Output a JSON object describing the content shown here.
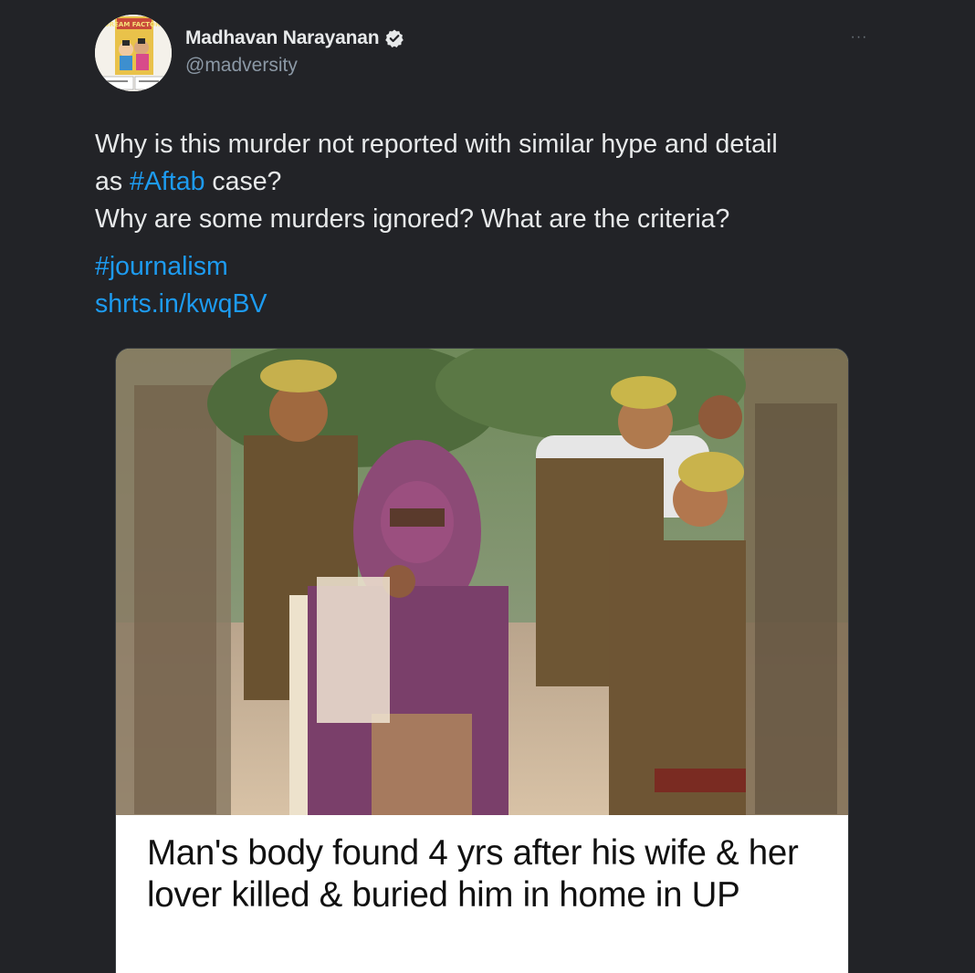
{
  "author": {
    "display_name": "Madhavan Narayanan",
    "handle": "@madversity",
    "verified": true,
    "avatar_caption": "DREAM FACTORY"
  },
  "tweet": {
    "line1": "Why is this murder not reported with similar hype and detail",
    "line2_prefix": "as ",
    "line2_hashtag": "#Aftab",
    "line2_suffix": " case?",
    "line3": "Why are some murders ignored? What are the criteria?",
    "hashtag": "#journalism",
    "link": "shrts.in/kwqBV"
  },
  "card": {
    "title": "Man's body found 4 yrs after his wife & her lover killed & buried him in home in UP"
  },
  "colors": {
    "background": "#222327",
    "text": "#e7e9ea",
    "secondary_text": "#8b98a5",
    "accent": "#1d9bf0"
  },
  "icons": {
    "verified": "verified-badge-icon",
    "more": "more-options-icon"
  }
}
